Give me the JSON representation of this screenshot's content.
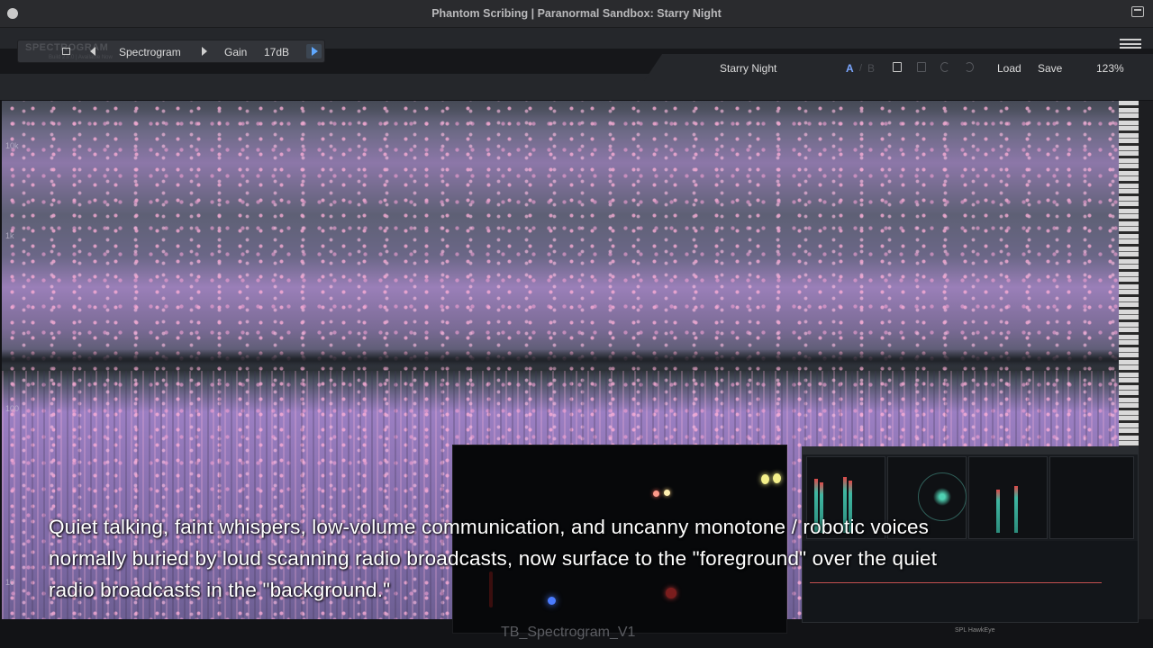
{
  "window": {
    "title": "Phantom Scribing | Paranormal Sandbox: Starry Night"
  },
  "toolbar": {
    "logo_text": "SPECTROGRAM",
    "logo_subtext": "Build 2.0.0 | Available Now",
    "view_label": "Spectrogram",
    "gain_label": "Gain",
    "gain_value": "17dB"
  },
  "preset_bar": {
    "preset_name": "Starry Night",
    "a_label": "A",
    "separator": "/",
    "b_label": "B",
    "load_label": "Load",
    "save_label": "Save",
    "zoom": "123%"
  },
  "spectrogram": {
    "freq_labels": [
      "10k",
      "1k",
      "100",
      "10"
    ]
  },
  "subtitle": {
    "lines": [
      "Quiet talking, faint whispers, low-volume communication, and uncanny monotone / robotic voices",
      "normally buried by loud scanning radio broadcasts, now surface to the \"foreground\" over the quiet",
      "radio broadcasts in the \"background.\""
    ]
  },
  "overlay": {
    "file_label": "TB_Spectrogram_V1",
    "watermark": "SPL HawkEye"
  },
  "colors": {
    "accent_blue": "#7ba7ff",
    "spectrogram_pink": "#ffafd7",
    "spectrogram_purple": "#8d74b4"
  }
}
